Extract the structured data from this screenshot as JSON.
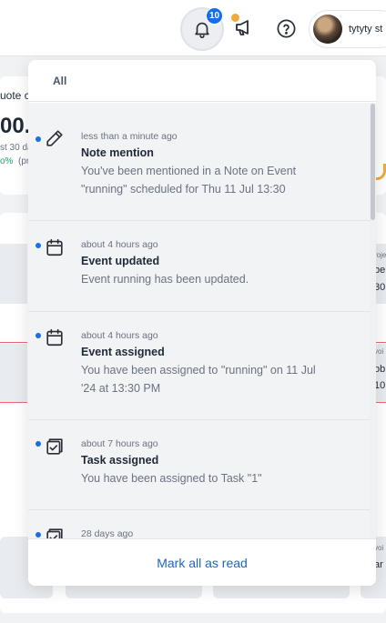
{
  "header": {
    "notification_count": "10",
    "user_name": "tytyty st"
  },
  "background": {
    "quote_label": "uote c",
    "big_value": "00.",
    "period_label": "st 30 da",
    "change_pct": "o%",
    "change_note": "(pr",
    "frag_proj": "roje",
    "frag_be": "be",
    "frag_30": "30",
    "frag_invoi": "voi",
    "frag_ob": "ob",
    "frag_10": "10",
    "frag_invoi2": "voi",
    "frag_ar": "ar"
  },
  "panel": {
    "tab_all": "All",
    "footer_action": "Mark all as read",
    "notifications": [
      {
        "icon": "pencil-icon",
        "time": "less than a minute ago",
        "title": "Note mention",
        "body": "You've been mentioned in a Note on Event \"running\" scheduled for Thu 11 Jul 13:30",
        "unread": true
      },
      {
        "icon": "calendar-icon",
        "time": "about 4 hours ago",
        "title": "Event updated",
        "body": "Event running has been updated.",
        "unread": true
      },
      {
        "icon": "calendar-icon",
        "time": "about 4 hours ago",
        "title": "Event assigned",
        "body": "You have been assigned to \"running\" on 11 Jul '24 at 13:30 PM",
        "unread": true
      },
      {
        "icon": "task-check-icon",
        "time": "about 7 hours ago",
        "title": "Task assigned",
        "body": "You have been assigned to Task \"1\"",
        "unread": true
      },
      {
        "icon": "task-check-icon",
        "time": "28 days ago",
        "title": "",
        "body": "",
        "unread": true
      }
    ]
  },
  "colors": {
    "accent": "#1470e8",
    "link": "#1c64c4",
    "announce_dot": "#f3a83b"
  }
}
